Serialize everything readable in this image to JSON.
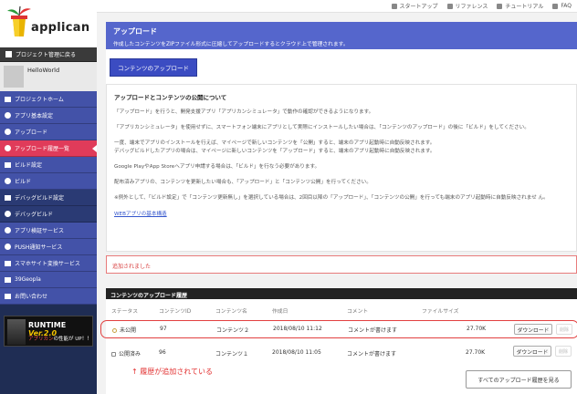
{
  "brand": {
    "logo_text": "applican"
  },
  "topbar": {
    "links": [
      {
        "label": "スタートアップ",
        "icon": "rocket-icon"
      },
      {
        "label": "リファレンス",
        "icon": "book-icon"
      },
      {
        "label": "チュートリアル",
        "icon": "tutorial-icon"
      },
      {
        "label": "FAQ",
        "icon": "faq-icon"
      }
    ]
  },
  "sidebar": {
    "back_label": "プロジェクト管理に戻る",
    "project_name": "HelloWorld",
    "items": [
      {
        "label": "プロジェクトホーム"
      },
      {
        "label": "アプリ基本設定"
      },
      {
        "label": "アップロード"
      },
      {
        "label": "アップロード履歴一覧"
      },
      {
        "label": "ビルド設定"
      },
      {
        "label": "ビルド"
      },
      {
        "label": "デバッグビルド設定"
      },
      {
        "label": "デバッグビルド"
      },
      {
        "label": "アプリ検証サービス"
      },
      {
        "label": "PUSH通知サービス"
      },
      {
        "label": "スマホサイト変換サービス"
      },
      {
        "label": "39Geopla"
      },
      {
        "label": "お問い合わせ"
      }
    ],
    "banner": {
      "title": "RUNTIME",
      "version": "Ver.2.0",
      "tagline_highlight": "アプリカン",
      "tagline_rest": "の性能が UP！！"
    }
  },
  "header": {
    "title": "アップロード",
    "description": "作成したコンテンツをZIPファイル形式に圧縮してアップロードするとクラウド上で管理されます。",
    "upload_button": "コンテンツのアップロード"
  },
  "info": {
    "title": "アップロードとコンテンツの公開について",
    "paragraphs": [
      "「アップロード」を行うと、開発支援アプリ「アプリカンシミュレータ」で動作の確認ができるようになります。",
      "「アプリカンシミュレータ」を使用せずに、スマートフォン端末にアプリとして実際にインストールしたい場合は、「コンテンツのアップロード」の後に「ビルド」をしてください。",
      "一度、端末でアプリのインストールを行えば、マイページで新しいコンテンツを「公開」すると、端末のアプリ起動時に自動反映されます。",
      "デバッグビルドしたアプリの場合は、マイページに新しいコンテンツを「アップロード」すると、端末のアプリ起動時に自動反映されます。",
      "Google PlayやApp Storeへアプリ申請する場合は、「ビルド」を行なう必要があります。",
      "配布済みアプリの、コンテンツを更新したい場合も、「アップロード」と「コンテンツ公開」を行ってください。",
      "※例外として、「ビルド設定」で「コンテンツ更新無し」を選択している場合は、2回目以降の「アップロード」、「コンテンツの公開」を行っても端末のアプリ起動時に自動反映されませ ん。"
    ],
    "link": "WEBアプリの基本構造"
  },
  "alert": {
    "message": "追加されました"
  },
  "history": {
    "title": "コンテンツのアップロード履歴",
    "columns": [
      "ステータス",
      "コンテンツID",
      "コンテンツ名",
      "作成日",
      "コメント",
      "ファイルサイズ"
    ],
    "rows": [
      {
        "status": "未公開",
        "id": "97",
        "name": "コンテンツ２",
        "date": "2018/08/10 11:12",
        "comment": "コメントが書けます",
        "size": "27.70K",
        "download": "ダウンロード",
        "delete": "削除"
      },
      {
        "status": "公開済み",
        "id": "96",
        "name": "コンテンツ１",
        "date": "2018/08/10 11:05",
        "comment": "コメントが書けます",
        "size": "27.70K",
        "download": "ダウンロード",
        "delete": "削除"
      }
    ],
    "annotation": "↑ 履歴が追加されている",
    "view_all_button": "すべてのアップロード履歴を見る"
  },
  "colors": {
    "sidebar_bg": "#1f2d54",
    "accent_blue": "#5566cc",
    "active_item": "#e03b5a",
    "alert_red": "#d84040"
  }
}
